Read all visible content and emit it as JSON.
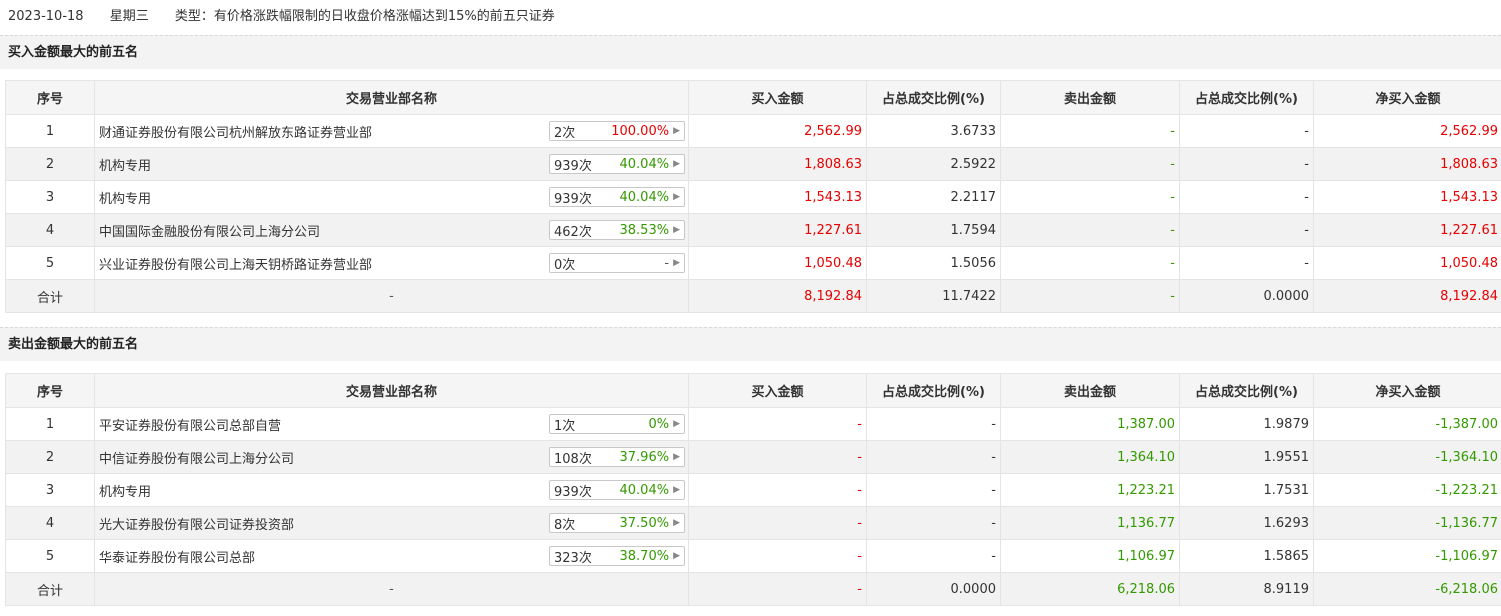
{
  "top": {
    "date": "2023-10-18",
    "weekday": "星期三",
    "type": "类型：有价格涨跌幅限制的日收盘价格涨幅达到15%的前五只证券"
  },
  "headers": [
    "序号",
    "交易营业部名称",
    "买入金额",
    "占总成交比例(%)",
    "卖出金额",
    "占总成交比例(%)",
    "净买入金额"
  ],
  "buy_section": {
    "title": "买入金额最大的前五名",
    "rows": [
      {
        "idx": "1",
        "name": "财通证券股份有限公司杭州解放东路证券营业部",
        "times": "2次",
        "pct": "100.00%",
        "pct_color": "red",
        "buy": "2,562.99",
        "buy_ratio": "3.6733",
        "sell": "-",
        "sell_ratio": "-",
        "net": "2,562.99"
      },
      {
        "idx": "2",
        "name": "机构专用",
        "times": "939次",
        "pct": "40.04%",
        "pct_color": "green",
        "buy": "1,808.63",
        "buy_ratio": "2.5922",
        "sell": "-",
        "sell_ratio": "-",
        "net": "1,808.63"
      },
      {
        "idx": "3",
        "name": "机构专用",
        "times": "939次",
        "pct": "40.04%",
        "pct_color": "green",
        "buy": "1,543.13",
        "buy_ratio": "2.2117",
        "sell": "-",
        "sell_ratio": "-",
        "net": "1,543.13"
      },
      {
        "idx": "4",
        "name": "中国国际金融股份有限公司上海分公司",
        "times": "462次",
        "pct": "38.53%",
        "pct_color": "green",
        "buy": "1,227.61",
        "buy_ratio": "1.7594",
        "sell": "-",
        "sell_ratio": "-",
        "net": "1,227.61"
      },
      {
        "idx": "5",
        "name": "兴业证券股份有限公司上海天钥桥路证券营业部",
        "times": "0次",
        "pct": "-",
        "pct_color": "gray",
        "buy": "1,050.48",
        "buy_ratio": "1.5056",
        "sell": "-",
        "sell_ratio": "-",
        "net": "1,050.48"
      }
    ],
    "total": {
      "label": "合计",
      "name": "-",
      "buy": "8,192.84",
      "buy_ratio": "11.7422",
      "sell": "-",
      "sell_ratio": "0.0000",
      "net": "8,192.84"
    }
  },
  "sell_section": {
    "title": "卖出金额最大的前五名",
    "rows": [
      {
        "idx": "1",
        "name": "平安证券股份有限公司总部自营",
        "times": "1次",
        "pct": "0%",
        "pct_color": "green",
        "buy": "-",
        "buy_ratio": "-",
        "sell": "1,387.00",
        "sell_ratio": "1.9879",
        "net": "-1,387.00"
      },
      {
        "idx": "2",
        "name": "中信证券股份有限公司上海分公司",
        "times": "108次",
        "pct": "37.96%",
        "pct_color": "green",
        "buy": "-",
        "buy_ratio": "-",
        "sell": "1,364.10",
        "sell_ratio": "1.9551",
        "net": "-1,364.10"
      },
      {
        "idx": "3",
        "name": "机构专用",
        "times": "939次",
        "pct": "40.04%",
        "pct_color": "green",
        "buy": "-",
        "buy_ratio": "-",
        "sell": "1,223.21",
        "sell_ratio": "1.7531",
        "net": "-1,223.21"
      },
      {
        "idx": "4",
        "name": "光大证券股份有限公司证券投资部",
        "times": "8次",
        "pct": "37.50%",
        "pct_color": "green",
        "buy": "-",
        "buy_ratio": "-",
        "sell": "1,136.77",
        "sell_ratio": "1.6293",
        "net": "-1,136.77"
      },
      {
        "idx": "5",
        "name": "华泰证券股份有限公司总部",
        "times": "323次",
        "pct": "38.70%",
        "pct_color": "green",
        "buy": "-",
        "buy_ratio": "-",
        "sell": "1,106.97",
        "sell_ratio": "1.5865",
        "net": "-1,106.97"
      }
    ],
    "total": {
      "label": "合计",
      "name": "-",
      "buy": "-",
      "buy_ratio": "0.0000",
      "sell": "6,218.06",
      "sell_ratio": "8.9119",
      "net": "-6,218.06"
    }
  },
  "icons": {
    "stat_arrow": "triangle-right-icon"
  }
}
